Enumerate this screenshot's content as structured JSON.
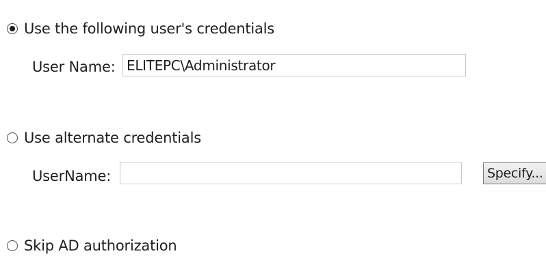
{
  "options": [
    {
      "label": "Use the following user's credentials",
      "selected": true
    },
    {
      "label": "Use alternate credentials",
      "selected": false
    },
    {
      "label": "Skip AD authorization",
      "selected": false
    }
  ],
  "current_user": {
    "label": "User Name:",
    "value": "ELITEPC\\Administrator"
  },
  "alternate": {
    "label": "UserName:",
    "value": "",
    "specify_label": "Specify..."
  }
}
